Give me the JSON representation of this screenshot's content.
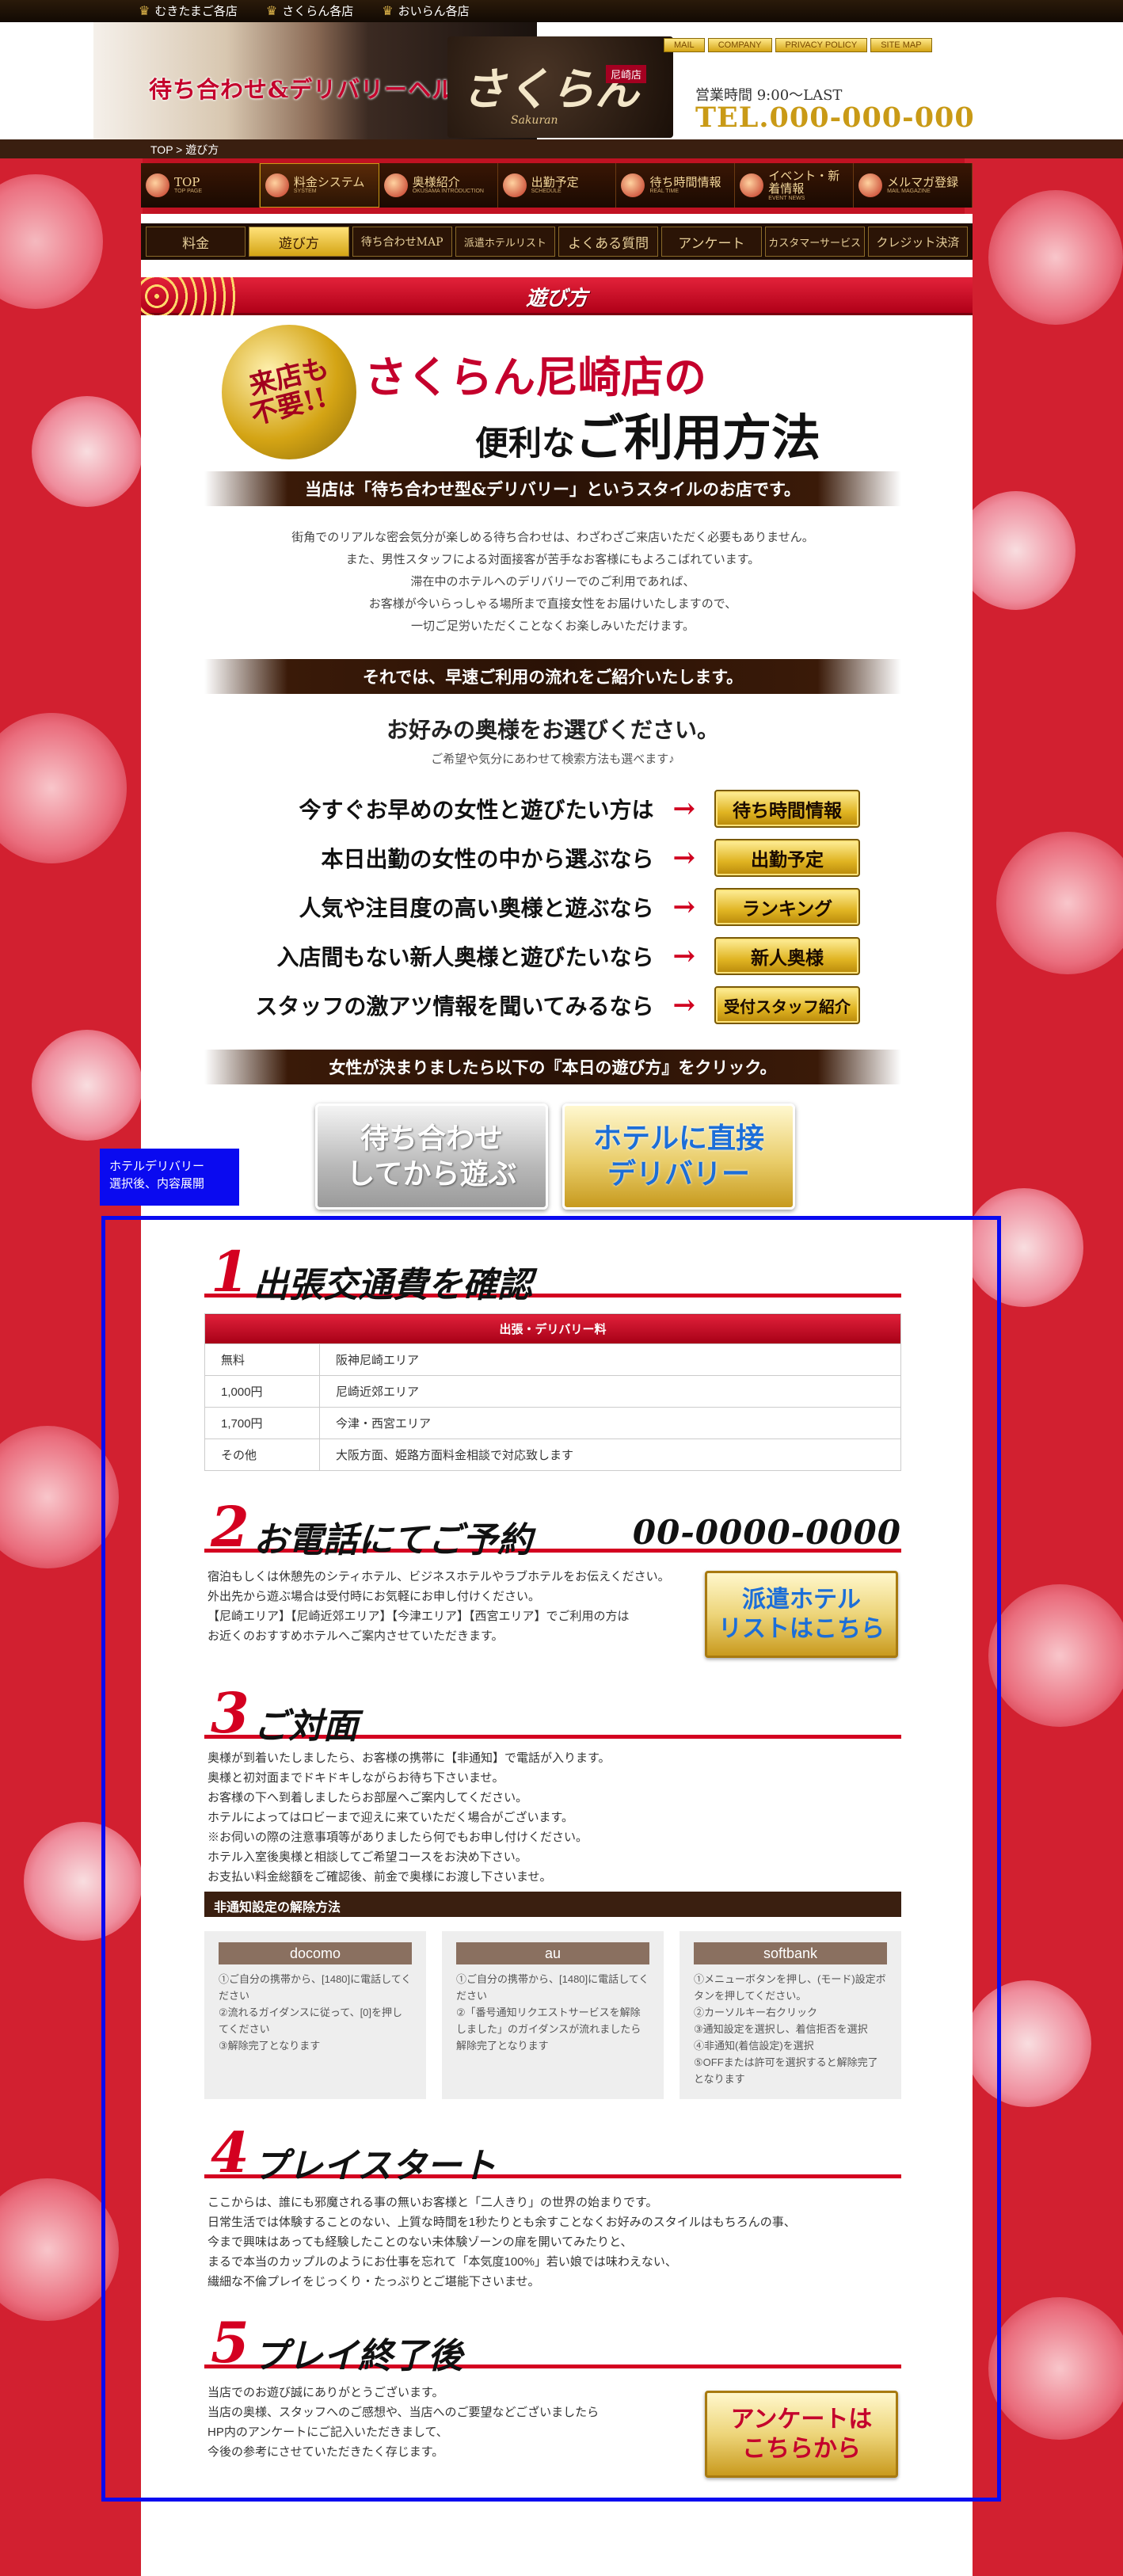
{
  "topbar": {
    "sites": [
      "むきたまご各店",
      "さくらん各店",
      "おいらん各店"
    ]
  },
  "header": {
    "tagline": "待ち合わせ&デリバリーヘルス",
    "logo_name": "さくらん",
    "logo_branch": "尼崎店",
    "logo_sub": "Sakuran",
    "nav": [
      "MAIL",
      "COMPANY",
      "PRIVACY POLICY",
      "SITE MAP"
    ],
    "hours": "営業時間 9:00～LAST",
    "tel": "TEL.000-000-000"
  },
  "breadcrumb": "TOP > 遊び方",
  "main_nav": [
    {
      "label": "TOP",
      "sub": "TOP PAGE"
    },
    {
      "label": "料金システム",
      "sub": "SYSTEM"
    },
    {
      "label": "奥様紹介",
      "sub": "OKUSAMA INTRODUCTION"
    },
    {
      "label": "出勤予定",
      "sub": "SCHEDULE"
    },
    {
      "label": "待ち時間情報",
      "sub": "REAL TIME"
    },
    {
      "label": "イベント・新着情報",
      "sub": "EVENT NEWS"
    },
    {
      "label": "メルマガ登録",
      "sub": "MAIL MAGAZINE"
    }
  ],
  "sub_tabs": [
    "料金",
    "遊び方",
    "待ち合わせMAP",
    "派遣ホテルリスト",
    "よくある質問",
    "アンケート",
    "カスタマーサービス",
    "クレジット決済"
  ],
  "section_title": "遊び方",
  "seal": [
    "来店も",
    "不要!!"
  ],
  "headline1": "さくらん尼崎店の",
  "headline2a": "便利な",
  "headline2b": "ご利用方法",
  "bar1": "当店は「待ち合わせ型&デリバリー」というスタイルのお店です。",
  "intro": [
    "街角でのリアルな密会気分が楽しめる待ち合わせは、わざわざご来店いただく必要もありません。",
    "また、男性スタッフによる対面接客が苦手なお客様にもよろこばれています。",
    "滞在中のホテルへのデリバリーでのご利用であれば、",
    "お客様が今いらっしゃる場所まで直接女性をお届けいたしますので、",
    "一切ご足労いただくことなくお楽しみいただけます。"
  ],
  "bar2": "それでは、早速ご利用の流れをご紹介いたします。",
  "choose_title": "お好みの奥様をお選びください。",
  "choose_sub": "ご希望や気分にあわせて検索方法も選べます♪",
  "choices": [
    {
      "text": "今すぐお早めの女性と遊びたい方は",
      "button": "待ち時間情報"
    },
    {
      "text": "本日出勤の女性の中から選ぶなら",
      "button": "出勤予定"
    },
    {
      "text": "人気や注目度の高い奥様と遊ぶなら",
      "button": "ランキング"
    },
    {
      "text": "入店間もない新人奥様と遊びたいなら",
      "button": "新人奥様"
    },
    {
      "text": "スタッフの激アツ情報を聞いてみるなら",
      "button": "受付スタッフ紹介"
    }
  ],
  "bar3": "女性が決まりましたら以下の『本日の遊び方』をクリック。",
  "big_buttons": {
    "meet_l1": "待ち合わせ",
    "meet_l2": "してから遊ぶ",
    "hotel_l1": "ホテルに直接",
    "hotel_l2": "デリバリー"
  },
  "blue_note": [
    "ホテルデリバリー",
    "選択後、内容展開"
  ],
  "steps": {
    "s1": {
      "num": "1",
      "label": "出張交通費を確認"
    },
    "s2": {
      "num": "2",
      "label": "お電話にてご予約",
      "tel": "00-0000-0000"
    },
    "s3": {
      "num": "3",
      "label": "ご対面"
    },
    "s4": {
      "num": "4",
      "label": "プレイスタート"
    },
    "s5": {
      "num": "5",
      "label": "プレイ終了後"
    }
  },
  "fee_table": {
    "header": "出張・デリバリー料",
    "rows": [
      {
        "price": "無料",
        "area": "阪神尼崎エリア"
      },
      {
        "price": "1,000円",
        "area": "尼崎近郊エリア"
      },
      {
        "price": "1,700円",
        "area": "今津・西宮エリア"
      },
      {
        "price": "その他",
        "area": "大阪方面、姫路方面料金相談で対応致します"
      }
    ]
  },
  "step2_text": [
    "宿泊もしくは休憩先のシティホテル、ビジネスホテルやラブホテルをお伝えください。",
    "外出先から遊ぶ場合は受付時にお気軽にお申し付けください。",
    "【尼崎エリア】【尼崎近郊エリア】【今津エリア】【西宮エリア】でご利用の方は",
    "お近くのおすすめホテルへご案内させていただきます。"
  ],
  "hotel_btn": {
    "l1": "派遣ホテル",
    "l2": "リストはこちら"
  },
  "step3_text": [
    "奥様が到着いたしましたら、お客様の携帯に【非通知】で電話が入ります。",
    "奥様と初対面までドキドキしながらお待ち下さいませ。",
    "お客様の下へ到着しましたらお部屋へご案内してください。",
    "ホテルによってはロビーまで迎えに来ていただく場合がございます。",
    "※お伺いの際の注意事項等がありましたら何でもお申し付けください。",
    "ホテル入室後奥様と相談してご希望コースをお決め下さい。",
    "お支払い料金総額をご確認後、前金で奥様にお渡し下さいませ。"
  ],
  "unblock_title": "非通知設定の解除方法",
  "carriers": [
    {
      "name": "docomo",
      "body": "①ご自分の携帯から、[1480]に電話してください\n②流れるガイダンスに従って、[0]を押してください\n③解除完了となります"
    },
    {
      "name": "au",
      "body": "①ご自分の携帯から、[1480]に電話してください\n②「番号通知リクエストサービスを解除しました」のガイダンスが流れましたら解除完了となります"
    },
    {
      "name": "softbank",
      "body": "①メニューボタンを押し、(モード)設定ボタンを押してください。\n②カーソルキー右クリック\n③通知設定を選択し、着信拒否を選択\n④非通知(着信設定)を選択\n⑤OFFまたは許可を選択すると解除完了となります"
    }
  ],
  "step4_text": [
    "ここからは、誰にも邪魔される事の無いお客様と「二人きり」の世界の始まりです。",
    "日常生活では体験することのない、上質な時間を1秒たりとも余すことなくお好みのスタイルはもちろんの事、",
    "今まで興味はあっても経験したことのない未体験ゾーンの扉を開いてみたりと、",
    "まるで本当のカップルのようにお仕事を忘れて「本気度100%」若い娘では味わえない、",
    "繊細な不倫プレイをじっくり・たっぷりとご堪能下さいませ。"
  ],
  "step5_text": [
    "当店でのお遊び誠にありがとうございます。",
    "当店の奥様、スタッフへのご感想や、当店へのご要望などございましたら",
    "HP内のアンケートにご記入いただきまして、",
    "今後の参考にさせていただきたく存じます。"
  ],
  "survey_btn": {
    "l1": "アンケートは",
    "l2": "こちらから"
  }
}
